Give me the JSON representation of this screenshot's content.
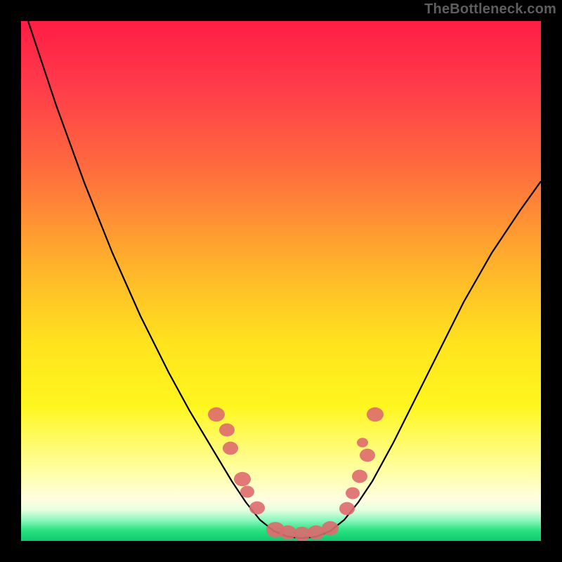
{
  "watermark": "TheBottleneck.com",
  "chart_data": {
    "type": "line",
    "title": "",
    "xlabel": "",
    "ylabel": "",
    "xlim": [
      0,
      740
    ],
    "ylim": [
      740,
      0
    ],
    "grid": false,
    "curve_points": [
      [
        10,
        0
      ],
      [
        50,
        120
      ],
      [
        90,
        230
      ],
      [
        130,
        330
      ],
      [
        170,
        420
      ],
      [
        210,
        500
      ],
      [
        240,
        555
      ],
      [
        270,
        605
      ],
      [
        300,
        655
      ],
      [
        320,
        685
      ],
      [
        340,
        710
      ],
      [
        360,
        726
      ],
      [
        380,
        734
      ],
      [
        400,
        736
      ],
      [
        420,
        734
      ],
      [
        440,
        726
      ],
      [
        460,
        710
      ],
      [
        480,
        685
      ],
      [
        500,
        655
      ],
      [
        530,
        600
      ],
      [
        560,
        540
      ],
      [
        590,
        480
      ],
      [
        630,
        400
      ],
      [
        670,
        330
      ],
      [
        710,
        270
      ],
      [
        740,
        228
      ]
    ],
    "markers": [
      {
        "x": 278,
        "y": 560,
        "r": 12
      },
      {
        "x": 293,
        "y": 582,
        "r": 11
      },
      {
        "x": 298,
        "y": 608,
        "r": 11
      },
      {
        "x": 315,
        "y": 652,
        "r": 12
      },
      {
        "x": 322,
        "y": 670,
        "r": 10
      },
      {
        "x": 336,
        "y": 693,
        "r": 11
      },
      {
        "x": 362,
        "y": 724,
        "r": 13
      },
      {
        "x": 380,
        "y": 728,
        "r": 12
      },
      {
        "x": 400,
        "y": 730,
        "r": 12
      },
      {
        "x": 420,
        "y": 728,
        "r": 12
      },
      {
        "x": 440,
        "y": 722,
        "r": 12
      },
      {
        "x": 464,
        "y": 694,
        "r": 11
      },
      {
        "x": 472,
        "y": 672,
        "r": 10
      },
      {
        "x": 482,
        "y": 648,
        "r": 11
      },
      {
        "x": 493,
        "y": 618,
        "r": 11
      },
      {
        "x": 486,
        "y": 600,
        "r": 8
      },
      {
        "x": 504,
        "y": 560,
        "r": 12
      }
    ],
    "tick_label": {
      "text": "",
      "x": 490,
      "y": 596
    }
  }
}
